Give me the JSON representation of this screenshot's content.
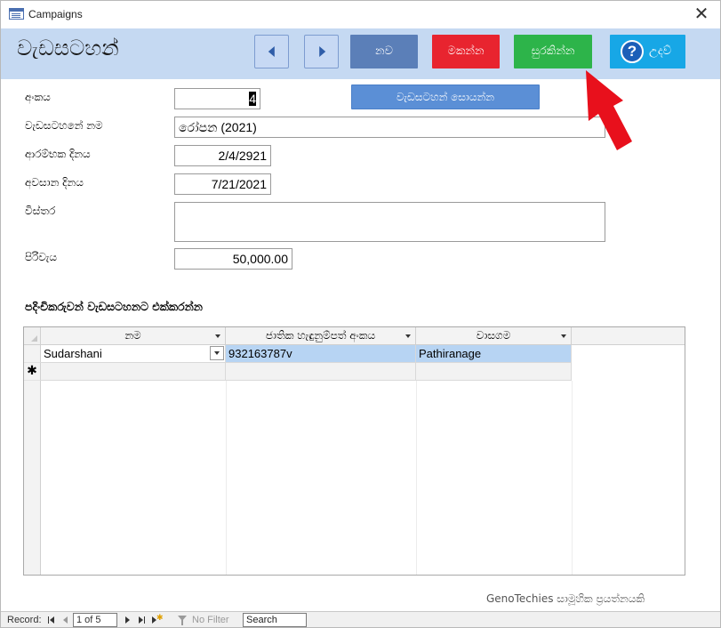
{
  "window": {
    "title": "Campaigns",
    "close_glyph": "✕"
  },
  "header": {
    "form_title": "වැඩසටහන්",
    "new_label": "නව",
    "delete_label": "මකන්න",
    "save_label": "සුරකින්න",
    "help_label": "උදව්",
    "help_glyph": "?"
  },
  "form": {
    "id_label": "අංකය",
    "id_value": "4",
    "name_label": "වැඩසටහනේ නම",
    "name_value": "රෝපන (2021)",
    "start_label": "ආරම්භක දිනය",
    "start_value": "2/4/2921",
    "end_label": "අවසාන දිනය",
    "end_value": "7/21/2021",
    "details_label": "විස්තර",
    "details_value": "",
    "cost_label": "පිරිවැය",
    "cost_value": "50,000.00",
    "search_campaign_label": "වැඩසටහන් සොයන්න"
  },
  "subform": {
    "title": "පදිංචිකරුවන් වැඩසටහනට එක්කරන්න",
    "columns": [
      "නම",
      "ජාතික හැඳුනුම්පත් අංකය",
      "වාසගම"
    ],
    "rows": [
      [
        "Sudarshani",
        "932163787v",
        "Pathiranage"
      ]
    ],
    "new_row_marker": "✱"
  },
  "footer_note": "GenoTechies සාමූහික ප්‍රයත්නයකි",
  "record_bar": {
    "record_label": "Record:",
    "position": "1 of 5",
    "no_filter_label": "No Filter",
    "search_value": "Search"
  },
  "colors": {
    "header_bg": "#c5d9f2",
    "new_button": "#5b7fb8",
    "delete_button": "#e8242f",
    "save_button": "#2db44a",
    "help_button": "#17a7e6",
    "annotation_arrow": "#e8101c"
  },
  "icons": {
    "app": "form-icon",
    "prev": "triangle-left-icon",
    "next": "triangle-right-icon",
    "help": "question-circle-icon",
    "annotation": "red-arrow-icon"
  }
}
